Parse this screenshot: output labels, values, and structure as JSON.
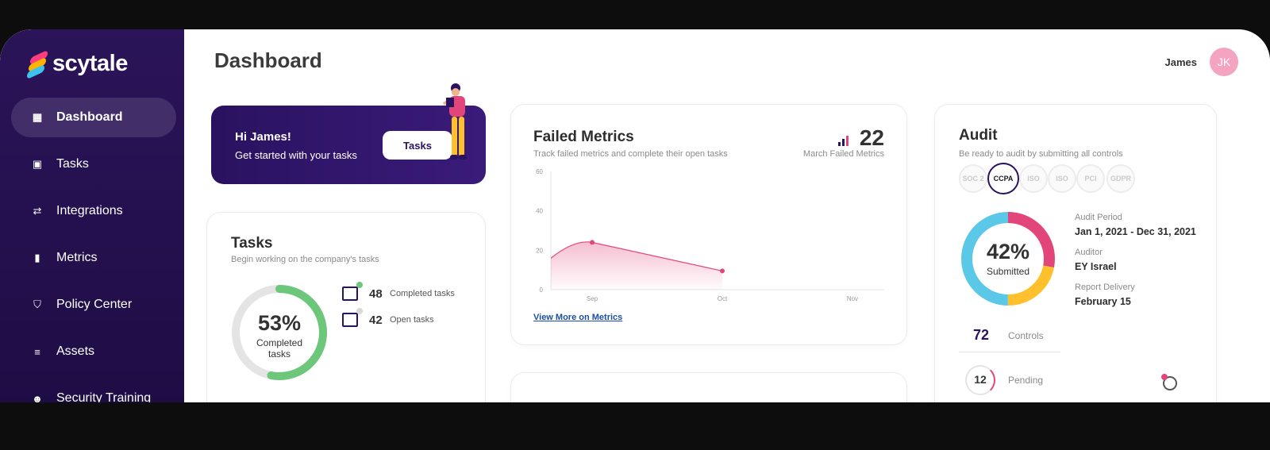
{
  "app": {
    "brand": "scytale"
  },
  "sidebar": {
    "items": [
      {
        "label": "Dashboard",
        "icon": "dashboard-icon",
        "active": true
      },
      {
        "label": "Tasks",
        "icon": "clipboard-icon"
      },
      {
        "label": "Integrations",
        "icon": "handshake-icon"
      },
      {
        "label": "Metrics",
        "icon": "bar-chart-icon"
      },
      {
        "label": "Policy Center",
        "icon": "shield-icon"
      },
      {
        "label": "Assets",
        "icon": "database-icon"
      },
      {
        "label": "Security Training",
        "icon": "user-check-icon"
      }
    ]
  },
  "header": {
    "title": "Dashboard",
    "user_name": "James",
    "avatar_initials": "JK"
  },
  "welcome": {
    "greeting": "Hi James!",
    "subtitle": "Get started with your tasks",
    "button": "Tasks"
  },
  "tasks_card": {
    "title": "Tasks",
    "subtitle": "Begin working on the company's tasks",
    "percent": "53%",
    "percent_label_1": "Completed",
    "percent_label_2": "tasks",
    "progress_fraction": 0.53,
    "completed_count": "48",
    "completed_label": "Completed tasks",
    "open_count": "42",
    "open_label": "Open tasks"
  },
  "metrics_card": {
    "title": "Failed Metrics",
    "subtitle": "Track failed metrics and complete their open tasks",
    "count": "22",
    "count_label": "March Failed Metrics",
    "link": "View More on Metrics"
  },
  "chart_data": {
    "type": "area",
    "x": [
      "Sep",
      "Oct",
      "Nov"
    ],
    "yticks": [
      "60",
      "40",
      "20",
      "0"
    ],
    "ylim": [
      0,
      60
    ],
    "points": [
      {
        "x": -0.32,
        "y": 16
      },
      {
        "x": 0,
        "y": 24
      },
      {
        "x": 1,
        "y": 9.5
      }
    ],
    "color": "#e2457a"
  },
  "audit_card": {
    "title": "Audit",
    "subtitle": "Be ready to audit by submitting all controls",
    "badges": [
      "SOC 2",
      "CCPA",
      "ISO",
      "ISO",
      "PCI",
      "GDPR"
    ],
    "percent": "42%",
    "percent_label": "Submitted",
    "ring_segments": [
      {
        "color": "#e2457a",
        "fraction": 0.28
      },
      {
        "color": "#ffc02e",
        "fraction": 0.22
      },
      {
        "color": "#5ac8e6",
        "fraction": 0.5
      }
    ],
    "period_label": "Audit Period",
    "period_value": "Jan 1, 2021 - Dec 31, 2021",
    "auditor_label": "Auditor",
    "auditor_value": "EY Israel",
    "delivery_label": "Report Delivery",
    "delivery_value": "February 15",
    "controls_count": "72",
    "controls_label": "Controls",
    "pending_count": "12",
    "pending_label": "Pending"
  },
  "colors": {
    "accent": "#2a1260",
    "green": "#6cc77a",
    "pink": "#e2457a"
  }
}
